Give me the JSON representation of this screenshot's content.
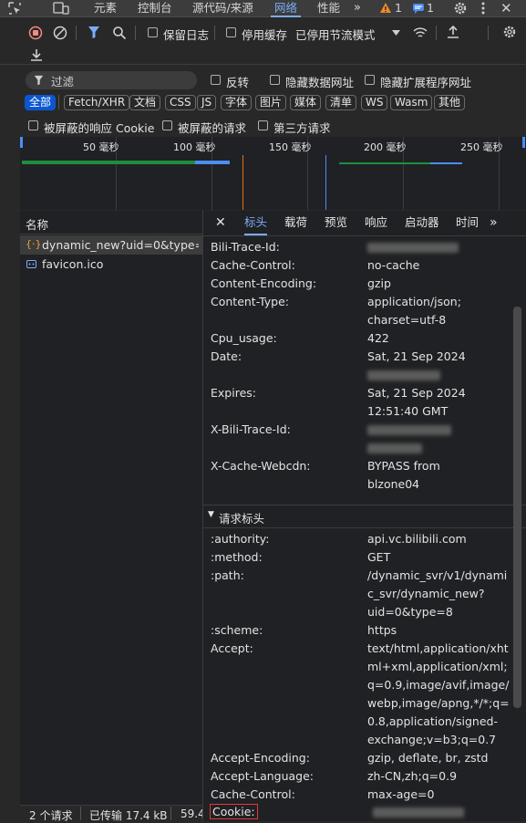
{
  "top_tabs": [
    {
      "label": "元素"
    },
    {
      "label": "控制台"
    },
    {
      "label": "源代码/来源"
    },
    {
      "label": "网络"
    },
    {
      "label": "性能"
    }
  ],
  "top_badges": {
    "warnings": "1",
    "issues": "1"
  },
  "toolbar": {
    "preserve_log": "保留日志",
    "disable_cache": "停用缓存",
    "throttling": "已停用节流模式"
  },
  "filter": {
    "placeholder": "过滤",
    "invert": "反转",
    "hide_data_urls": "隐藏数据网址",
    "hide_ext_urls": "隐藏扩展程序网址",
    "types": [
      "全部",
      "Fetch/XHR",
      "文档",
      "CSS",
      "JS",
      "字体",
      "图片",
      "媒体",
      "清单",
      "WS",
      "Wasm",
      "其他"
    ],
    "blocked_cookies": "被屏蔽的响应 Cookie",
    "blocked_requests": "被屏蔽的请求",
    "third_party": "第三方请求"
  },
  "timeline": {
    "ticks": [
      "50 毫秒",
      "100 毫秒",
      "150 毫秒",
      "200 毫秒",
      "250 毫秒"
    ]
  },
  "requests": {
    "header": "名称",
    "items": [
      {
        "name": "dynamic_new?uid=0&type=8"
      },
      {
        "name": "favicon.ico"
      }
    ]
  },
  "detail_tabs": [
    "标头",
    "载荷",
    "预览",
    "响应",
    "启动器",
    "时间"
  ],
  "response_headers": [
    {
      "key": "Bili-Trace-Id:",
      "value": ""
    },
    {
      "key": "Cache-Control:",
      "value": "no-cache"
    },
    {
      "key": "Content-Encoding:",
      "value": "gzip"
    },
    {
      "key": "Content-Type:",
      "value": "application/json;\ncharset=utf-8"
    },
    {
      "key": "Cpu_usage:",
      "value": "422"
    },
    {
      "key": "Date:",
      "value": "Sat, 21 Sep 2024"
    },
    {
      "key": "Expires:",
      "value": "Sat, 21 Sep 2024\n12:51:40 GMT"
    },
    {
      "key": "X-Bili-Trace-Id:",
      "value": ""
    },
    {
      "key": "X-Cache-Webcdn:",
      "value": "BYPASS from\nblzone04"
    }
  ],
  "request_section_title": "请求标头",
  "request_headers": [
    {
      "key": ":authority:",
      "value": "api.vc.bilibili.com"
    },
    {
      "key": ":method:",
      "value": "GET"
    },
    {
      "key": ":path:",
      "value": "/dynamic_svr/v1/dynami\nc_svr/dynamic_new?\nuid=0&type=8"
    },
    {
      "key": ":scheme:",
      "value": "https"
    },
    {
      "key": "Accept:",
      "value": "text/html,application/xht\nml+xml,application/xml;\nq=0.9,image/avif,image/\nwebp,image/apng,*/*;q=\n0.8,application/signed-\nexchange;v=b3;q=0.7"
    },
    {
      "key": "Accept-Encoding:",
      "value": "gzip, deflate, br, zstd"
    },
    {
      "key": "Accept-Language:",
      "value": "zh-CN,zh;q=0.9"
    },
    {
      "key": "Cache-Control:",
      "value": "max-age=0"
    },
    {
      "key": "Cookie:",
      "value": ""
    }
  ],
  "status": {
    "requests": "2 个请求",
    "transferred": "已传输 17.4 kB",
    "resources": "59.4"
  },
  "colors": {
    "accent": "#7cacf8",
    "active_pill": "#0b57d0",
    "highlight_box": "#e53935"
  }
}
